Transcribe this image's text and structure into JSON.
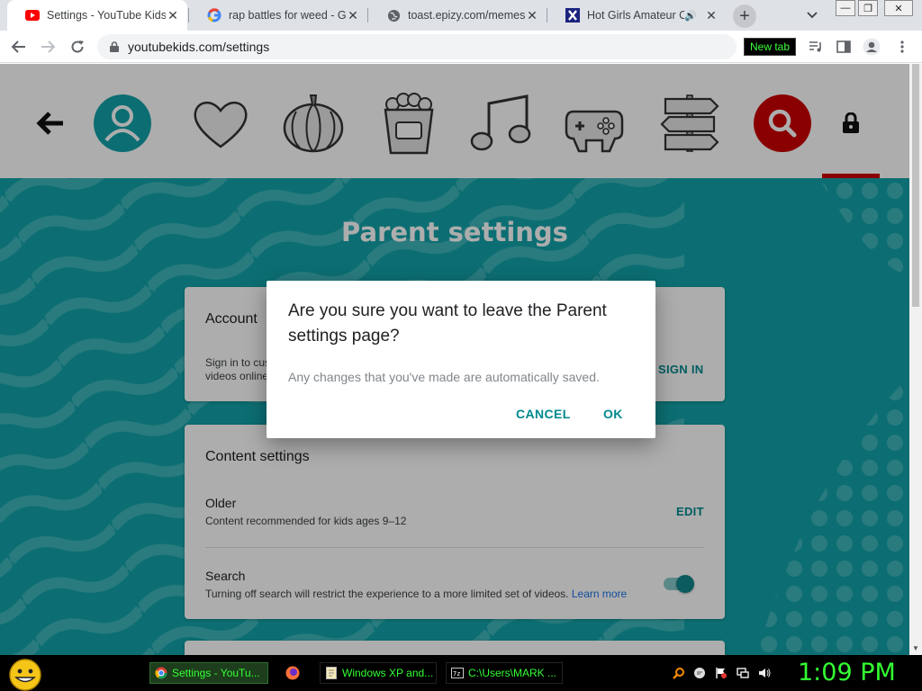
{
  "browser": {
    "tabs": [
      {
        "title": "Settings - YouTube Kids",
        "icon": "youtube-icon",
        "active": true
      },
      {
        "title": "rap battles for weed - Go",
        "icon": "google-icon",
        "active": false
      },
      {
        "title": "toast.epizy.com/memes/i",
        "icon": "globe-icon",
        "active": false
      },
      {
        "title": "Hot Girls Amateur Co",
        "icon": "x-site-icon",
        "active": false,
        "audio": true
      }
    ],
    "tab_close_glyph": "✕",
    "new_tab_glyph": "+",
    "new_tab_tooltip": "New tab",
    "url": "youtubekids.com/settings",
    "window_controls": [
      "—",
      "❐",
      "✕"
    ]
  },
  "ytkids": {
    "nav_icons": [
      "back-arrow-icon",
      "profile-icon",
      "heart-icon",
      "pumpkin-icon",
      "popcorn-icon",
      "music-note-icon",
      "gamepad-icon",
      "signpost-icon",
      "search-icon",
      "lock-icon"
    ],
    "page_title": "Parent settings",
    "account_card": {
      "heading": "Account",
      "line1": "Sign in to cus",
      "line2": "videos online",
      "action": "SIGN IN"
    },
    "content_card": {
      "heading": "Content settings",
      "older_title": "Older",
      "older_desc": "Content recommended for kids ages 9–12",
      "older_action": "EDIT",
      "search_title": "Search",
      "search_desc": "Turning off search will restrict the experience to a more limited set of videos.",
      "learn_more": "Learn more",
      "search_enabled": true
    },
    "dialog": {
      "title": "Are you sure you want to leave the Parent settings page?",
      "body": "Any changes that you've made are automatically saved.",
      "cancel": "CANCEL",
      "ok": "OK"
    },
    "colors": {
      "teal": "#12a3a8",
      "accent": "#00898e",
      "search_red": "#cc0000"
    }
  },
  "taskbar": {
    "items": [
      {
        "label": "Settings - YouTu...",
        "icon": "chrome-icon",
        "active": true
      },
      {
        "label": "",
        "icon": "firefox-icon",
        "active": false
      },
      {
        "label": "Windows XP and...",
        "icon": "document-icon",
        "active": false
      },
      {
        "label": "C:\\Users\\MARK ...",
        "icon": "cmd-icon",
        "active": false
      }
    ],
    "tray_icons": [
      "search-tray-icon",
      "messenger-tray-icon",
      "flag-tray-icon",
      "network-tray-icon",
      "volume-tray-icon"
    ],
    "clock": "1:09 PM"
  }
}
